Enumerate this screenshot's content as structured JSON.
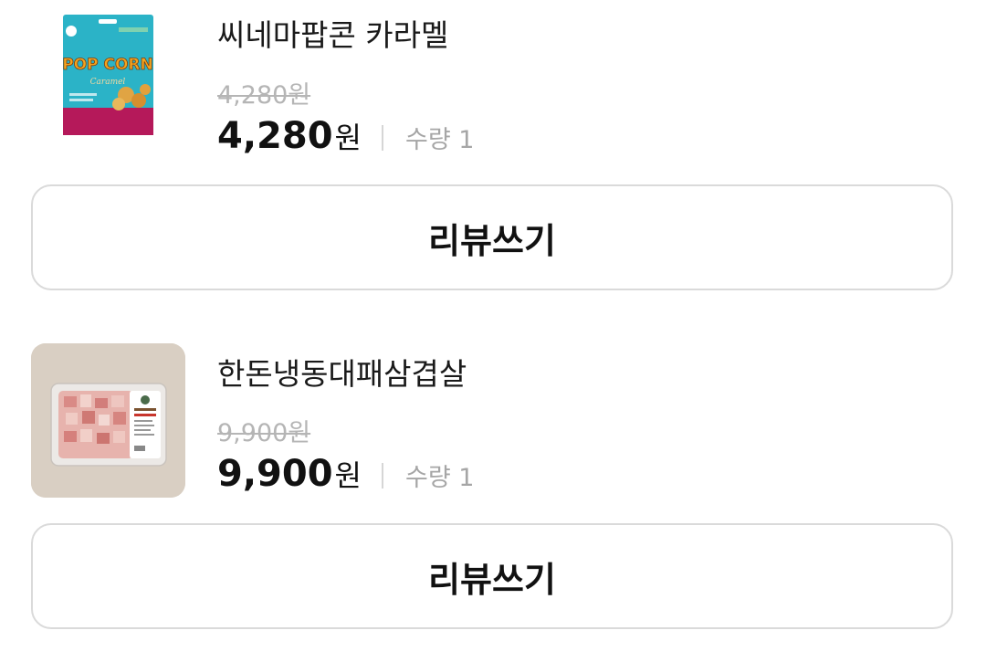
{
  "orders": [
    {
      "image": "caramel-popcorn-package-image",
      "package_text": "POP CORN",
      "package_subtext": "Caramel",
      "name": "씨네마팝콘 카라멜",
      "original_price": "4,280원",
      "price": "4,280",
      "price_unit": "원",
      "quantity": "수량 1",
      "review_label": "리뷰쓰기"
    },
    {
      "image": "frozen-pork-belly-tray-image",
      "name": "한돈냉동대패삼겹살",
      "original_price": "9,900원",
      "price": "9,900",
      "price_unit": "원",
      "quantity": "수량 1",
      "review_label": "리뷰쓰기"
    }
  ],
  "colors": {
    "text": "#111111",
    "strikethrough": "#b5b5b5",
    "quantity": "#a6a6a6",
    "border": "#dadada",
    "popcorn_bag": "#2bb3c7",
    "meat_background": "#d9cfc3"
  }
}
